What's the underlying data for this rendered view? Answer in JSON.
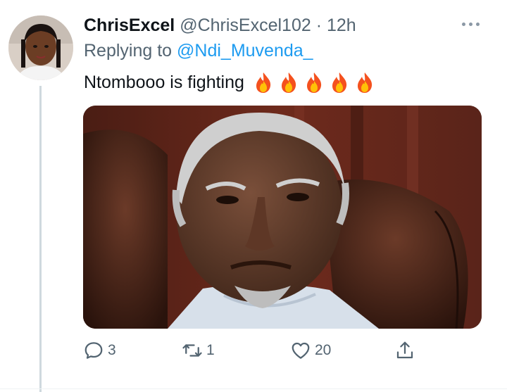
{
  "tweet": {
    "display_name": "ChrisExcel",
    "handle": "@ChrisExcel102",
    "separator": "·",
    "time": "12h",
    "replying_to_prefix": "Replying to",
    "replying_to_handle": "@Ndi_Muvenda_",
    "text": "Ntombooo is fighting",
    "emoji": [
      "fire-icon",
      "fire-icon",
      "fire-icon",
      "fire-icon",
      "fire-icon"
    ],
    "media_description_icon": "photo"
  },
  "actions": {
    "reply_icon": "reply-icon",
    "reply_count": "3",
    "retweet_icon": "retweet-icon",
    "retweet_count": "1",
    "like_icon": "heart-icon",
    "like_count": "20",
    "share_icon": "share-icon"
  },
  "colors": {
    "text_primary": "#0f1419",
    "text_secondary": "#536471",
    "link": "#1d9bf0",
    "thread_line": "#cfd9de"
  }
}
